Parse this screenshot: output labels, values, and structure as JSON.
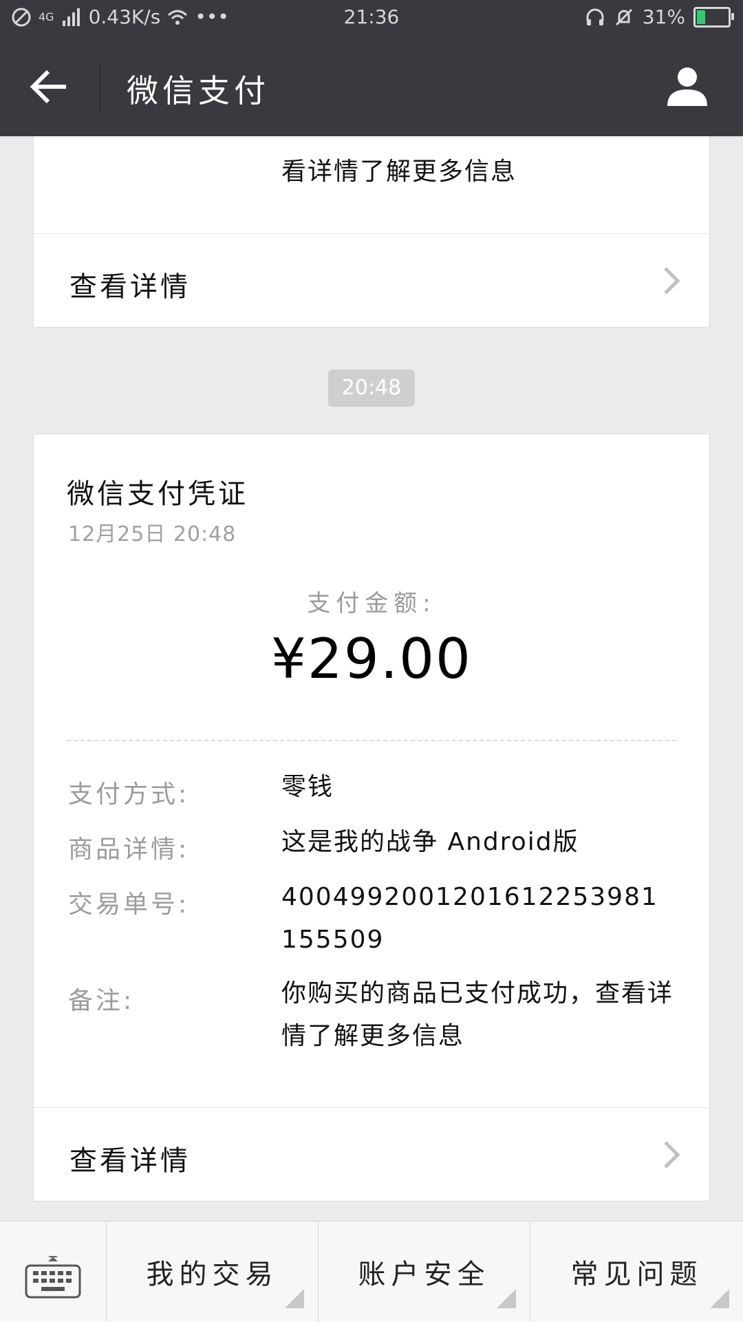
{
  "status_bar": {
    "network": "4G",
    "speed": "0.43K/s",
    "time": "21:36",
    "battery": "31%",
    "battery_level": 0.31,
    "icons": [
      "blocked-icon",
      "signal-icon",
      "wifi-icon",
      "more-dots-icon",
      "headset-icon",
      "mute-bell-icon",
      "battery-icon"
    ]
  },
  "nav": {
    "title": "微信支付",
    "icons": [
      "back-arrow-icon",
      "user-profile-icon"
    ]
  },
  "previous_card": {
    "note_tail": "看详情了解更多信息",
    "details_label": "查看详情"
  },
  "message_time": "20:48",
  "receipt": {
    "title": "微信支付凭证",
    "date": "12月25日  20:48",
    "amount_label": "支付金额:",
    "amount": "¥29.00",
    "rows": [
      {
        "key": "支付方式:",
        "value": "零钱"
      },
      {
        "key": "商品详情:",
        "value": "这是我的战争 Android版"
      },
      {
        "key": "交易单号:",
        "value": "4004992001201612253981155509"
      },
      {
        "key": "备注:",
        "value": "你购买的商品已支付成功，查看详情了解更多信息"
      }
    ],
    "details_label": "查看详情"
  },
  "bottom_tabs": [
    {
      "label": "我的交易"
    },
    {
      "label": "账户安全"
    },
    {
      "label": "常见问题"
    }
  ],
  "keyboard_icon": "keyboard-icon",
  "colors": {
    "header_bg": "#393a3f",
    "page_bg": "#ebebeb",
    "battery_green": "#2ecc71"
  }
}
